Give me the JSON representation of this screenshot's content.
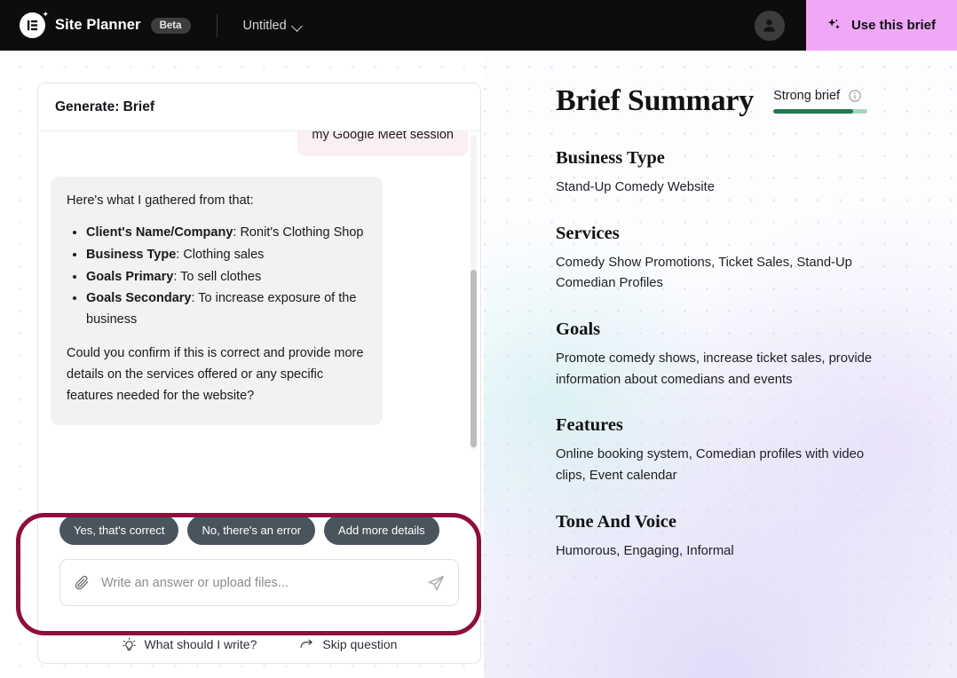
{
  "topbar": {
    "logo_icon": "elementor-e-icon",
    "brand_name": "Site Planner",
    "badge": "Beta",
    "doc_title": "Untitled",
    "chevron_icon": "chevron-down-icon",
    "avatar_icon": "user-avatar-icon",
    "use_brief_label": "Use this brief",
    "use_brief_icon": "sparkles-icon",
    "use_brief_color": "#efa8f5"
  },
  "chat": {
    "header": "Generate: Brief",
    "user_message": "my Google Meet session",
    "assistant": {
      "intro": "Here's what I gathered from that:",
      "items": [
        {
          "label": "Client's Name/Company",
          "value": ": Ronit's Clothing Shop"
        },
        {
          "label": "Business Type",
          "value": ": Clothing sales"
        },
        {
          "label": "Goals Primary",
          "value": ": To sell clothes"
        },
        {
          "label": "Goals Secondary",
          "value": ": To increase exposure of the business"
        }
      ],
      "closing": "Could you confirm if this is correct and provide more details on the services offered or any specific features needed for the website?"
    },
    "chips": [
      "Yes, that's correct",
      "No, there's an error",
      "Add more details"
    ],
    "input_placeholder": "Write an answer or upload files...",
    "input_value": "",
    "attach_icon": "paperclip-icon",
    "send_icon": "send-paper-plane-icon",
    "highlight_color": "#8e0e3e",
    "footer_links": [
      {
        "icon": "lightbulb-icon",
        "label": "What should I write?"
      },
      {
        "icon": "skip-arrow-icon",
        "label": "Skip question"
      }
    ]
  },
  "brief": {
    "title": "Brief Summary",
    "strength_label": "Strong brief",
    "strength_info_icon": "info-circle-icon",
    "strength_percent": 85,
    "strength_fill_color": "#227a50",
    "strength_track_color": "#a8d5bf",
    "sections": [
      {
        "title": "Business Type",
        "body": "Stand-Up Comedy Website"
      },
      {
        "title": "Services",
        "body": "Comedy Show Promotions, Ticket Sales, Stand-Up Comedian Profiles"
      },
      {
        "title": "Goals",
        "body": "Promote comedy shows, increase ticket sales, provide information about comedians and events"
      },
      {
        "title": "Features",
        "body": "Online booking system, Comedian profiles with video clips, Event calendar"
      },
      {
        "title": "Tone And Voice",
        "body": "Humorous, Engaging, Informal"
      }
    ]
  }
}
